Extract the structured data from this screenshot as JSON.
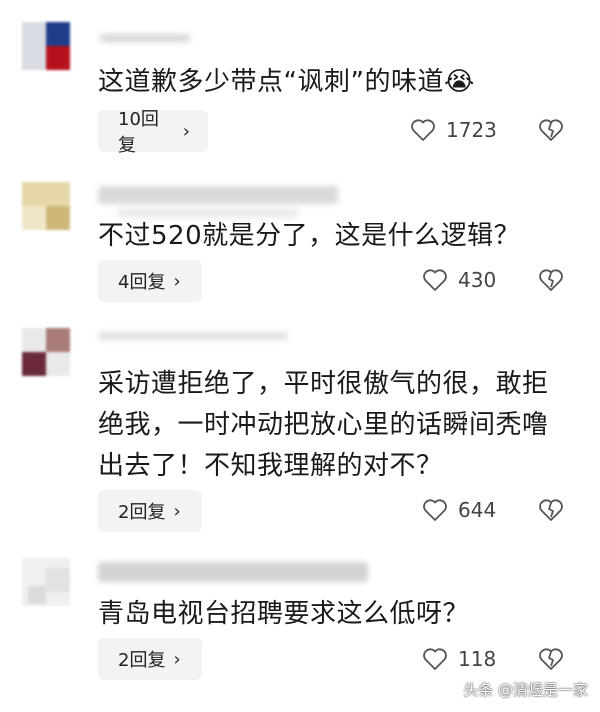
{
  "comments": [
    {
      "text": "这道歉多少带点“讽刺”的味道",
      "emoji": "😭",
      "replies": "10回复",
      "likes": "1723"
    },
    {
      "text": "不过520就是分了，这是什么逻辑？",
      "replies": "4回复",
      "likes": "430"
    },
    {
      "text": "采访遭拒绝了，平时很傲气的很，敢拒绝我，一时冲动把放心里的话瞬间秃噜出去了！不知我理解的对不？",
      "replies": "2回复",
      "likes": "644"
    },
    {
      "text": "青岛电视台招聘要求这么低呀？",
      "replies": "2回复",
      "likes": "118"
    }
  ],
  "reply_chevron": "›",
  "watermark": {
    "prefix": "头条",
    "author": "@清煜是一家"
  },
  "colors": {
    "reply_bg": "#f3f3f3",
    "text": "#1a1a1a",
    "icon": "#555555"
  },
  "icons": {
    "like": "heart-outline-icon",
    "dislike": "broken-heart-icon"
  }
}
